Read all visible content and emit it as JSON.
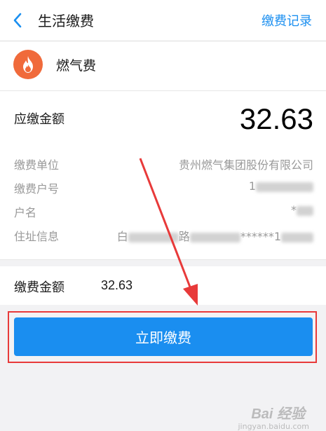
{
  "header": {
    "title": "生活缴费",
    "records_link": "缴费记录",
    "back_icon": "chevron-left-icon"
  },
  "service": {
    "name": "燃气费",
    "icon": "flame-icon"
  },
  "bill": {
    "due_label": "应缴金额",
    "due_amount": "32.63",
    "rows": [
      {
        "label": "缴费单位",
        "value": "贵州燃气集团股份有限公司"
      },
      {
        "label": "缴费户号",
        "value_prefix": "1"
      },
      {
        "label": "户名",
        "value_prefix": "*"
      },
      {
        "label": "住址信息",
        "value_prefix": "白",
        "value_mid": "路",
        "value_mid2": "******1"
      }
    ]
  },
  "payment": {
    "amount_label": "缴费金额",
    "amount_value": "32.63",
    "pay_button": "立即缴费"
  },
  "watermark": {
    "text": "Bai 经验",
    "sub": "jingyan.baidu.com"
  },
  "colors": {
    "accent": "#1a8ef0",
    "flame": "#f06a3b",
    "highlight": "#e83a3a"
  }
}
